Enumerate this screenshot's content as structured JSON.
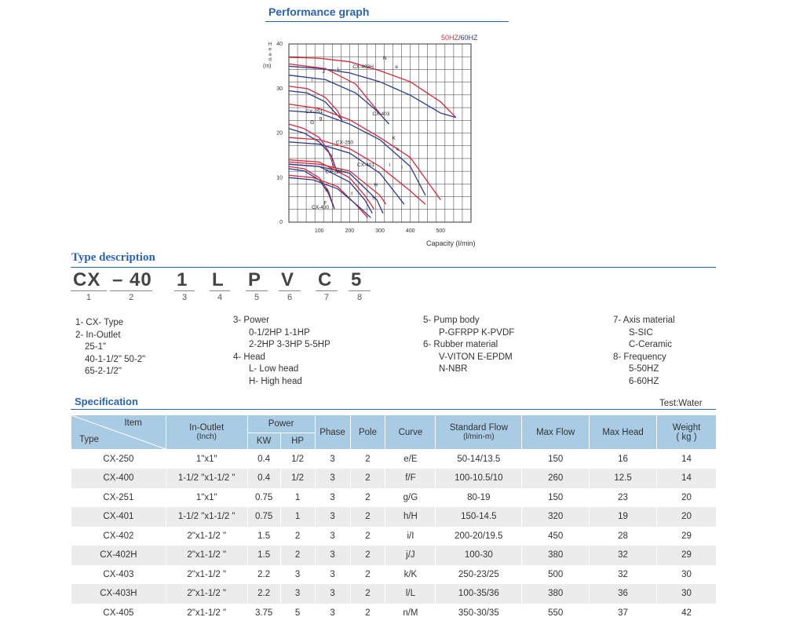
{
  "performance": {
    "title": "Performance graph",
    "legend_50": "50HZ",
    "legend_sep": "/",
    "legend_60": "60HZ",
    "y_label_chars": [
      "H",
      "e",
      "a",
      "d"
    ],
    "y_unit": "(m)",
    "x_label": "Capacity (l/min)",
    "colors": {
      "hz50": "#d9283a",
      "hz60": "#2b3a8c",
      "grid": "#333333"
    }
  },
  "chart_data": {
    "type": "line",
    "title": "Performance graph",
    "xlabel": "Capacity (l/min)",
    "ylabel": "Head (m)",
    "xlim": [
      0,
      600
    ],
    "ylim": [
      0,
      40
    ],
    "x_ticks": [
      "100",
      "200",
      "300",
      "400",
      "500"
    ],
    "y_ticks": [
      "0",
      "10",
      "20",
      "30",
      "40"
    ],
    "grid": true,
    "legend": "top-right",
    "labels": [
      {
        "text": "CX-403H",
        "x": 210,
        "y": 34.5
      },
      {
        "text": "N",
        "x": 310,
        "y": 36.5
      },
      {
        "text": "e",
        "x": 350,
        "y": 34.5
      },
      {
        "text": "J",
        "x": 110,
        "y": 33.5
      },
      {
        "text": "L",
        "x": 160,
        "y": 34
      },
      {
        "text": "l",
        "x": 75,
        "y": 31.5
      },
      {
        "text": "CX-251",
        "x": 55,
        "y": 24.5
      },
      {
        "text": "CX-403",
        "x": 275,
        "y": 24
      },
      {
        "text": "g",
        "x": 100,
        "y": 23
      },
      {
        "text": "G",
        "x": 70,
        "y": 22
      },
      {
        "text": "CX-250",
        "x": 155,
        "y": 17.5
      },
      {
        "text": "K",
        "x": 340,
        "y": 18.5
      },
      {
        "text": "k",
        "x": 355,
        "y": 16
      },
      {
        "text": "CX-401",
        "x": 225,
        "y": 12.5
      },
      {
        "text": "i",
        "x": 330,
        "y": 12.5
      },
      {
        "text": "I",
        "x": 370,
        "y": 12
      },
      {
        "text": "CX-250",
        "x": 120,
        "y": 11
      },
      {
        "text": "H",
        "x": 280,
        "y": 8
      },
      {
        "text": "a",
        "x": 120,
        "y": 7
      },
      {
        "text": "f",
        "x": 205,
        "y": 6
      },
      {
        "text": "h",
        "x": 275,
        "y": 5
      },
      {
        "text": "F",
        "x": 115,
        "y": 4
      },
      {
        "text": "CX-400",
        "x": 75,
        "y": 3
      }
    ],
    "series": [
      {
        "color": "#d9283a",
        "x": [
          0,
          100,
          200,
          300,
          400,
          500,
          550
        ],
        "y": [
          37,
          36.8,
          36,
          34,
          31.5,
          27,
          23.5
        ]
      },
      {
        "color": "#2b3a8c",
        "x": [
          0,
          100,
          200,
          300,
          400,
          500,
          550
        ],
        "y": [
          35,
          34.5,
          33.5,
          31.5,
          28.5,
          24.5,
          23.5
        ]
      },
      {
        "color": "#d9283a",
        "x": [
          0,
          60,
          120,
          160,
          175
        ],
        "y": [
          30.5,
          30,
          28,
          25,
          23
        ]
      },
      {
        "color": "#2b3a8c",
        "x": [
          0,
          60,
          120,
          160,
          175
        ],
        "y": [
          29.5,
          29,
          27,
          24,
          23
        ]
      },
      {
        "color": "#d9283a",
        "x": [
          0,
          120,
          220,
          280,
          305
        ],
        "y": [
          35.5,
          34.5,
          31,
          26,
          24
        ]
      },
      {
        "color": "#2b3a8c",
        "x": [
          0,
          120,
          220,
          290,
          330
        ],
        "y": [
          33,
          32,
          29,
          25,
          22
        ]
      },
      {
        "color": "#d9283a",
        "x": [
          0,
          100,
          200,
          300,
          400,
          500
        ],
        "y": [
          26.5,
          25.5,
          23,
          19,
          14.5,
          5
        ]
      },
      {
        "color": "#2b3a8c",
        "x": [
          0,
          100,
          200,
          300,
          400,
          450
        ],
        "y": [
          25,
          24.5,
          22,
          18.5,
          12.5,
          6
        ]
      },
      {
        "color": "#d9283a",
        "x": [
          0,
          50,
          100,
          130,
          150
        ],
        "y": [
          22,
          21,
          19,
          16,
          12
        ]
      },
      {
        "color": "#2b3a8c",
        "x": [
          0,
          50,
          100,
          140,
          160
        ],
        "y": [
          21,
          20,
          18,
          15,
          11
        ]
      },
      {
        "color": "#d9283a",
        "x": [
          0,
          100,
          200,
          300,
          400,
          450
        ],
        "y": [
          19,
          18.5,
          16.5,
          12.5,
          7,
          4
        ]
      },
      {
        "color": "#2b3a8c",
        "x": [
          0,
          100,
          200,
          300,
          380
        ],
        "y": [
          18,
          17.5,
          15.5,
          11,
          4
        ]
      },
      {
        "color": "#d9283a",
        "x": [
          0,
          100,
          200,
          300,
          320
        ],
        "y": [
          13.5,
          13,
          11.5,
          6,
          4
        ]
      },
      {
        "color": "#2b3a8c",
        "x": [
          0,
          100,
          200,
          290,
          310
        ],
        "y": [
          13,
          12.5,
          11,
          5,
          2
        ]
      },
      {
        "color": "#d9283a",
        "x": [
          0,
          50,
          100,
          130,
          150
        ],
        "y": [
          12.5,
          12,
          10,
          7,
          3
        ]
      },
      {
        "color": "#2b3a8c",
        "x": [
          0,
          50,
          100,
          130,
          150
        ],
        "y": [
          12,
          11.5,
          9.5,
          6.5,
          3
        ]
      },
      {
        "color": "#d9283a",
        "x": [
          0,
          80,
          160,
          220,
          260
        ],
        "y": [
          10.5,
          10,
          8,
          4,
          1
        ]
      },
      {
        "color": "#2b3a8c",
        "x": [
          0,
          80,
          160,
          230,
          270
        ],
        "y": [
          10,
          9.5,
          7.5,
          3.5,
          1
        ]
      },
      {
        "color": "#d9283a",
        "x": [
          0,
          100,
          200,
          250,
          280
        ],
        "y": [
          14,
          13.5,
          10,
          6,
          3
        ]
      },
      {
        "color": "#2b3a8c",
        "x": [
          0,
          100,
          200,
          250,
          275
        ],
        "y": [
          13,
          12.5,
          9,
          5,
          2
        ]
      }
    ]
  },
  "type_description": {
    "title": "Type description",
    "code": [
      {
        "ch": "CX",
        "num": "1"
      },
      {
        "ch": "– 40",
        "num": "2"
      },
      {
        "ch": "1",
        "num": "3"
      },
      {
        "ch": "L",
        "num": "4"
      },
      {
        "ch": "P",
        "num": "5"
      },
      {
        "ch": "V",
        "num": "6"
      },
      {
        "ch": "C",
        "num": "7"
      },
      {
        "ch": "5",
        "num": "8"
      }
    ],
    "col1": [
      "1- CX- Type",
      "2- In-Outlet",
      "25-1\"",
      "40-1-1/2\"  50-2\"",
      "65-2-1/2\""
    ],
    "col2": [
      "3- Power",
      "0-1/2HP   1-1HP",
      "2-2HP  3-3HP   5-5HP",
      "4- Head",
      "L- Low head",
      "H- High head"
    ],
    "col3": [
      "5- Pump body",
      "P-GFRPP   K-PVDF",
      "6- Rubber material",
      "V-VITON   E-EPDM",
      "N-NBR"
    ],
    "col4": [
      "7- Axis material",
      "S-SIC",
      "C-Ceramic",
      "8- Frequency",
      "5-50HZ",
      "6-60HZ"
    ]
  },
  "specification": {
    "title": "Specification",
    "test_note": "Test:Water",
    "headers": {
      "item": "Item",
      "type": "Type",
      "in_outlet": "In-Outlet",
      "in_outlet_unit": "(Inch)",
      "power": "Power",
      "kw": "KW",
      "hp": "HP",
      "phase": "Phase",
      "pole": "Pole",
      "curve": "Curve",
      "standard_flow": "Standard Flow",
      "standard_flow_unit": "(l/min-m)",
      "max_flow": "Max Flow",
      "max_head": "Max Head",
      "weight": "Weight",
      "weight_unit": "( kg )"
    },
    "rows": [
      [
        "CX-250",
        "1\"x1\"",
        "0.4",
        "1/2",
        "3",
        "2",
        "e/E",
        "50-14/13.5",
        "150",
        "16",
        "14"
      ],
      [
        "CX-400",
        "1-1/2 \"x1-1/2 \"",
        "0.4",
        "1/2",
        "3",
        "2",
        "f/F",
        "100-10.5/10",
        "260",
        "12.5",
        "14"
      ],
      [
        "CX-251",
        "1\"x1\"",
        "0.75",
        "1",
        "3",
        "2",
        "g/G",
        "80-19",
        "150",
        "23",
        "20"
      ],
      [
        "CX-401",
        "1-1/2 \"x1-1/2 \"",
        "0.75",
        "1",
        "3",
        "2",
        "h/H",
        "150-14.5",
        "320",
        "19",
        "20"
      ],
      [
        "CX-402",
        "2\"x1-1/2 \"",
        "1.5",
        "2",
        "3",
        "2",
        "i/I",
        "200-20/19.5",
        "450",
        "28",
        "29"
      ],
      [
        "CX-402H",
        "2\"x1-1/2 \"",
        "1.5",
        "2",
        "3",
        "2",
        "j/J",
        "100-30",
        "380",
        "32",
        "29"
      ],
      [
        "CX-403",
        "2\"x1-1/2 \"",
        "2.2",
        "3",
        "3",
        "2",
        "k/K",
        "250-23/25",
        "500",
        "32",
        "30"
      ],
      [
        "CX-403H",
        "2\"x1-1/2 \"",
        "2.2",
        "3",
        "3",
        "2",
        "l/L",
        "100-35/36",
        "380",
        "36",
        "30"
      ],
      [
        "CX-405",
        "2\"x1-1/2 \"",
        "3.75",
        "5",
        "3",
        "2",
        "n/M",
        "350-30/35",
        "550",
        "37",
        "42"
      ]
    ]
  }
}
